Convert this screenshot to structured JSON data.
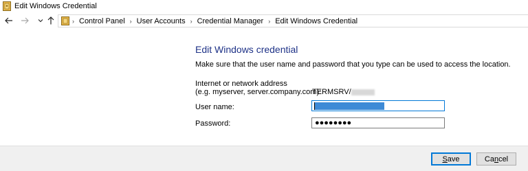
{
  "window": {
    "title": "Edit Windows Credential",
    "icon": "credential-manager-icon"
  },
  "navigation": {
    "back_icon": "arrow-left-icon",
    "forward_icon": "arrow-right-icon",
    "recent_icon": "chevron-down-icon",
    "up_icon": "arrow-up-icon"
  },
  "breadcrumb": {
    "items": [
      {
        "label": "Control Panel"
      },
      {
        "label": "User Accounts"
      },
      {
        "label": "Credential Manager"
      },
      {
        "label": "Edit Windows Credential"
      }
    ],
    "separator": "›"
  },
  "form": {
    "heading": "Edit Windows credential",
    "description": "Make sure that the user name and password that you type can be used to access the location.",
    "address_label_line1": "Internet or network address",
    "address_label_line2": "(e.g. myserver, server.company.com):",
    "address_value": "TERMSRV/",
    "username_label": "User name:",
    "password_label": "Password:",
    "password_value": "●●●●●●●●"
  },
  "buttons": {
    "save_mnemonic": "S",
    "save_rest": "ave",
    "cancel_prefix": "Ca",
    "cancel_mnemonic": "n",
    "cancel_rest": "cel"
  },
  "colors": {
    "heading": "#1e3287",
    "focus_border": "#0078d7",
    "selection": "#3e8ad6",
    "footer_bg": "#f0f0f0"
  }
}
